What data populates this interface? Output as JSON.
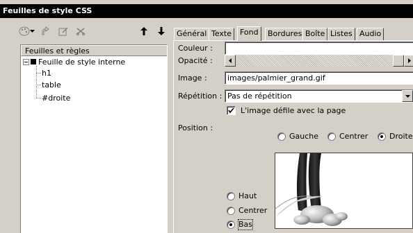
{
  "window": {
    "title": "Feuilles de style CSS"
  },
  "toolbar": {
    "icons": [
      "palette-icon",
      "chevron-down-icon",
      "new-rule-icon",
      "edit-icon",
      "delete-icon",
      "move-up-icon",
      "move-down-icon"
    ]
  },
  "tree": {
    "header": "Feuilles et règles",
    "root": "Feuille de style interne",
    "rules": [
      "h1",
      "table",
      "#droite"
    ]
  },
  "tabs": [
    "Général",
    "Texte",
    "Fond",
    "Bordures",
    "Boîte",
    "Listes",
    "Audio"
  ],
  "active_tab": "Fond",
  "form": {
    "couleur_label": "Couleur :",
    "couleur_value": "",
    "opacite_label": "Opacité :",
    "image_label": "Image :",
    "image_value": "images/palmier_grand.gif",
    "repetition_label": "Répétition :",
    "repetition_value": "Pas de répétition",
    "scroll_label": "L'image défile avec la page",
    "scroll_checked": true,
    "position_label": "Position :",
    "horizontal": {
      "options": [
        "Gauche",
        "Centrer",
        "Droite"
      ],
      "selected": "Droite"
    },
    "vertical": {
      "options": [
        "Haut",
        "Centrer",
        "Bas"
      ],
      "selected": "Bas"
    }
  },
  "colors": {
    "titlebar": "#000000",
    "panel": "#d4d0c8",
    "field": "#ffffff"
  }
}
